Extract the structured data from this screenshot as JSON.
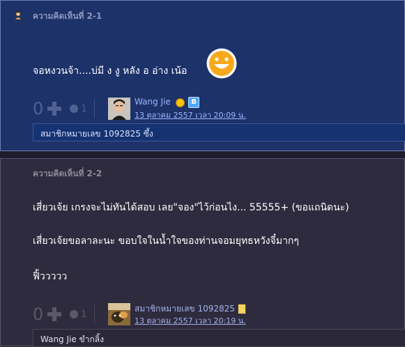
{
  "comments": [
    {
      "header": "ความคิดเห็นที่ 2-1",
      "lines": [
        "จอหงวนจ้า....บ่มี ง งู หลัง อ อ่าง เน้อ"
      ],
      "vote_count": "0",
      "emotion_count": "1",
      "poster_name": "Wang Jie",
      "poster_time": "13 ตุลาคม 2557 เวลา 20:09 น.",
      "badge_label": "B",
      "reply_preview": "สมาชิกหมายเลข 1092825 ซึ้ง"
    },
    {
      "header": "ความคิดเห็นที่ 2-2",
      "lines": [
        "เสี่ยวเจ้ย เกรงจะไม่ทันได้สอบ เลย\"จอง\"ไว้ก่อนไง... 55555+ (ขอแถนิดนะ)",
        "เสี่ยวเจ้ยขอลาละนะ ขอบใจในน้ำใจของท่านจอมยุทธหวังจี๋มากๆ",
        "ฟิ้ววววว"
      ],
      "vote_count": "0",
      "emotion_count": "1",
      "poster_name": "สมาชิกหมายเลข 1092825",
      "poster_time": "13 ตุลาคม 2557 เวลา 20:19 น.",
      "reply_preview": "Wang Jie ขำกลิ้ง"
    }
  ],
  "icons": {
    "user": "user-icon",
    "smiley": "smiley-icon",
    "plus": "plus-icon",
    "emotion": "emotion-icon",
    "badge_emo": "laugh-badge-icon",
    "badge_b": "b-badge-icon",
    "badge_phone": "phone-badge-icon"
  },
  "colors": {
    "c1_bg": "#1c3269",
    "c2_bg": "#2e2b3e",
    "link": "#9fb4ff"
  }
}
